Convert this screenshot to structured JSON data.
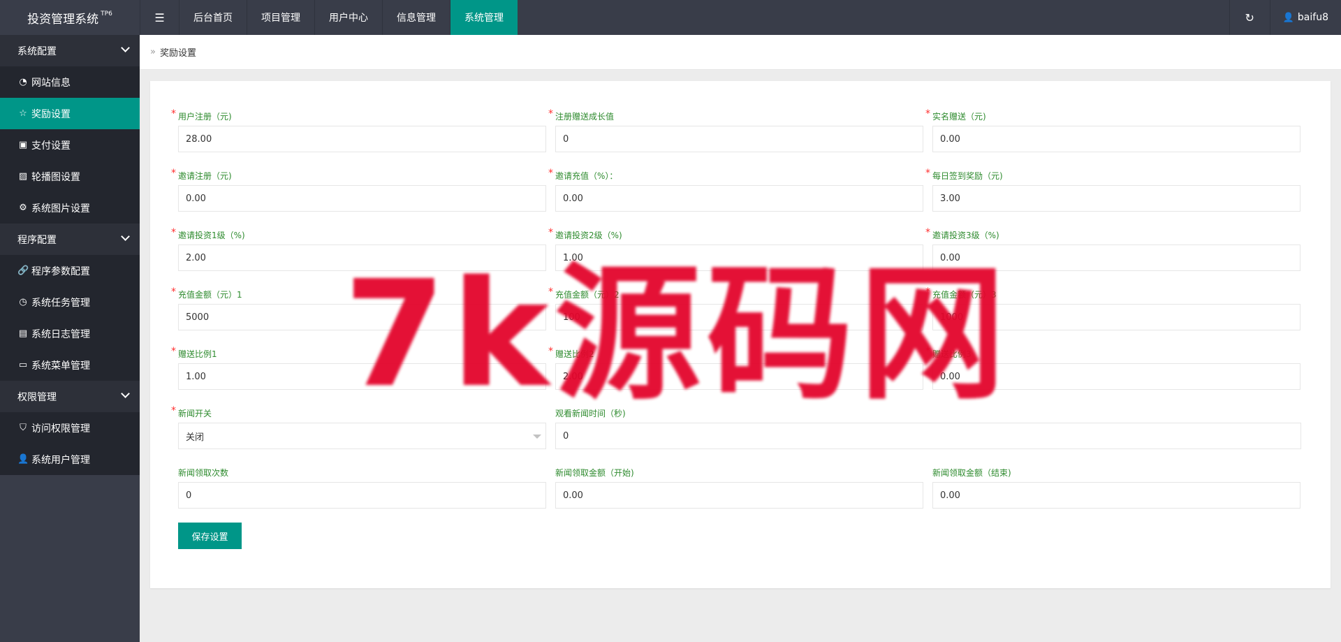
{
  "app": {
    "title": "投资管理系统",
    "title_sup": "TP6",
    "toggle_icon": "menu-fold-icon"
  },
  "topnav": {
    "items": [
      {
        "label": "后台首页",
        "active": false
      },
      {
        "label": "项目管理",
        "active": false
      },
      {
        "label": "用户中心",
        "active": false
      },
      {
        "label": "信息管理",
        "active": false
      },
      {
        "label": "系统管理",
        "active": true
      }
    ],
    "refresh_icon": "refresh-icon",
    "username": "baifu8"
  },
  "sidebar": {
    "groups": [
      {
        "title": "系统配置",
        "items": [
          {
            "label": "网站信息",
            "icon": "dashboard-icon",
            "active": false
          },
          {
            "label": "奖励设置",
            "icon": "star-icon",
            "active": true
          },
          {
            "label": "支付设置",
            "icon": "money-icon",
            "active": false
          },
          {
            "label": "轮播图设置",
            "icon": "picture-icon",
            "active": false
          },
          {
            "label": "系统图片设置",
            "icon": "gear-icon",
            "active": false
          }
        ]
      },
      {
        "title": "程序配置",
        "items": [
          {
            "label": "程序参数配置",
            "icon": "link-icon",
            "active": false
          },
          {
            "label": "系统任务管理",
            "icon": "clock-icon",
            "active": false
          },
          {
            "label": "系统日志管理",
            "icon": "log-icon",
            "active": false
          },
          {
            "label": "系统菜单管理",
            "icon": "window-icon",
            "active": false
          }
        ]
      },
      {
        "title": "权限管理",
        "items": [
          {
            "label": "访问权限管理",
            "icon": "shield-icon",
            "active": false
          },
          {
            "label": "系统用户管理",
            "icon": "user-icon",
            "active": false
          }
        ]
      }
    ]
  },
  "breadcrumb": {
    "separator": "»",
    "current": "奖励设置"
  },
  "form": {
    "rows": [
      [
        {
          "label": "用户注册（元)",
          "required": true,
          "value": "28.00"
        },
        {
          "label": "注册赠送成长值",
          "required": true,
          "value": "0"
        },
        {
          "label": "实名赠送（元)",
          "required": true,
          "value": "0.00"
        }
      ],
      [
        {
          "label": "邀请注册（元)",
          "required": true,
          "value": "0.00"
        },
        {
          "label": "邀请充值（%）：",
          "required": true,
          "value": "0.00"
        },
        {
          "label": "每日签到奖励（元)",
          "required": true,
          "value": "3.00"
        }
      ],
      [
        {
          "label": "邀请投资1级（%)",
          "required": true,
          "value": "2.00"
        },
        {
          "label": "邀请投资2级（%)",
          "required": true,
          "value": "1.00"
        },
        {
          "label": "邀请投资3级（%)",
          "required": true,
          "value": "0.00"
        }
      ],
      [
        {
          "label": "充值金额（元）1",
          "required": true,
          "value": "5000"
        },
        {
          "label": "充值金额（元）2",
          "required": true,
          "value": "100"
        },
        {
          "label": "充值金额（元）3",
          "required": true,
          "value": "1000"
        }
      ],
      [
        {
          "label": "赠送比例1",
          "required": true,
          "value": "1.00"
        },
        {
          "label": "赠送比例2",
          "required": true,
          "value": "2.00"
        },
        {
          "label": "赠送比例3",
          "required": true,
          "value": "0.00"
        }
      ]
    ],
    "news_switch": {
      "label": "新闻开关",
      "required": true,
      "value": "关闭"
    },
    "news_watch_time": {
      "label": "观看新闻时间（秒)",
      "required": false,
      "value": "0"
    },
    "last_row": [
      {
        "label": "新闻领取次数",
        "required": false,
        "value": "0"
      },
      {
        "label": "新闻领取金额（开始)",
        "required": false,
        "value": "0.00"
      },
      {
        "label": "新闻领取金额（结束)",
        "required": false,
        "value": "0.00"
      }
    ],
    "save_label": "保存设置"
  },
  "watermark": {
    "text": "7k源码网"
  },
  "colors": {
    "header_bg": "#393d49",
    "sidebar_bg": "#23262e",
    "accent": "#009688",
    "label_green": "#2e8b2e",
    "required_red": "#ff3030",
    "watermark_red": "#e3052c"
  }
}
